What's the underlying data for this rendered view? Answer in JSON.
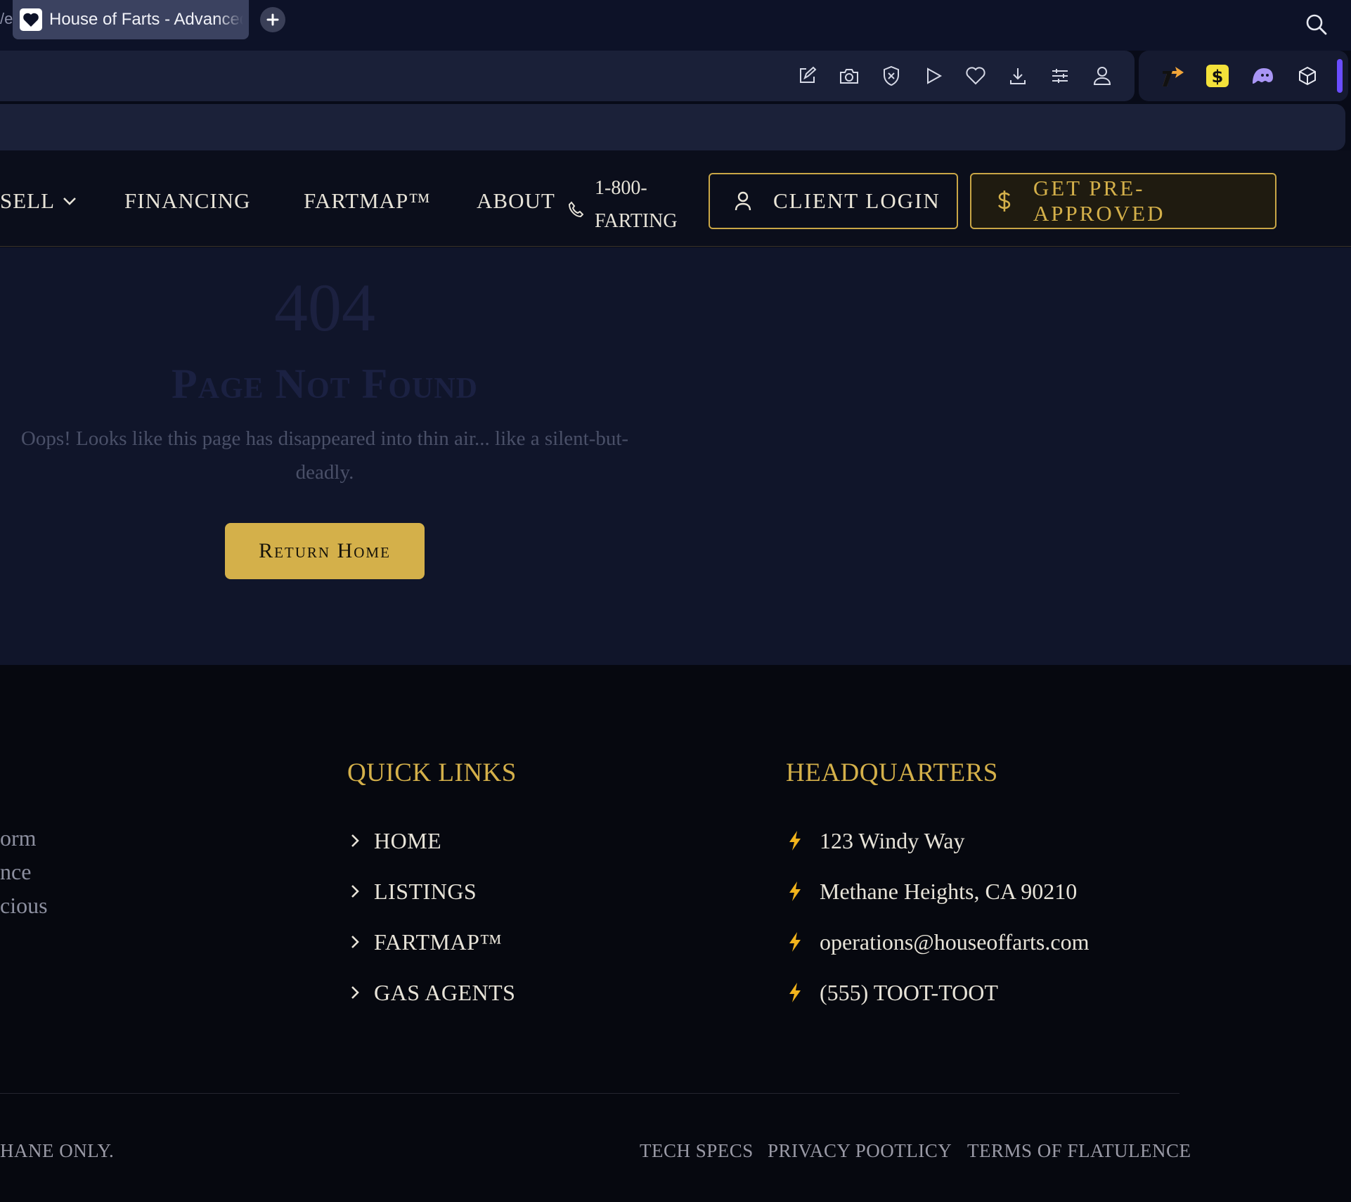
{
  "browser": {
    "tab_edge": "/e",
    "tab_title": "House of Farts - Advanced",
    "toolbar_icons": [
      "edit-icon",
      "camera-icon",
      "shield-x-icon",
      "play-icon",
      "heart-icon",
      "download-icon",
      "sliders-icon",
      "profile-icon"
    ],
    "extension_icons": [
      "arrow-ext-icon",
      "dollar-ext-icon",
      "ghost-ext-icon",
      "cube-ext-icon"
    ]
  },
  "nav": {
    "sell": "SELL",
    "financing": "FINANCING",
    "fartmap": "FARTMAP™",
    "about": "ABOUT",
    "phone_line1": "1-800-",
    "phone_line2": "FARTING",
    "login": "CLIENT LOGIN",
    "preapproved": "GET PRE-APPROVED"
  },
  "error": {
    "code": "404",
    "title": "Page Not Found",
    "message": "Oops! Looks like this page has disappeared into thin air... like a silent-but-deadly.",
    "button": "Return Home"
  },
  "footer": {
    "partial_lines": [
      "orm",
      "nce",
      "cious"
    ],
    "quick_links_title": "QUICK LINKS",
    "quick_links": [
      "HOME",
      "LISTINGS",
      "FARTMAP™",
      "GAS AGENTS"
    ],
    "hq_title": "HEADQUARTERS",
    "hq": [
      "123 Windy Way",
      "Methane Heights, CA 90210",
      "operations@houseoffarts.com",
      "(555) TOOT-TOOT"
    ],
    "copyright": "HANE ONLY.",
    "legal": [
      "TECH SPECS",
      "PRIVACY POOTLICY",
      "TERMS OF FLATULENCE"
    ]
  },
  "colors": {
    "gold": "#d4b04a",
    "navy": "#10152a",
    "footer": "#06080f"
  }
}
